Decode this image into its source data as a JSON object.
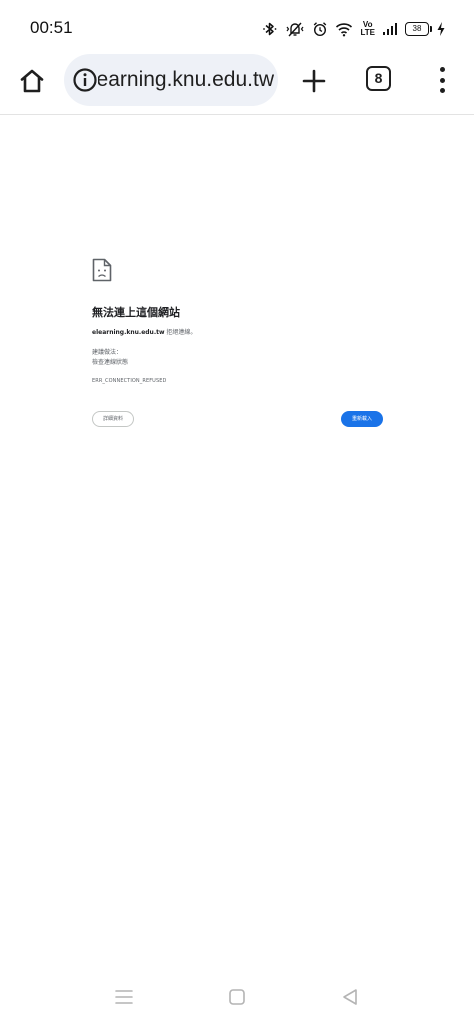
{
  "status_bar": {
    "time": "00:51",
    "network_label_top": "Vo",
    "network_label_bottom": "LTE",
    "battery_level": "38",
    "icons": [
      "bluetooth-icon",
      "vibrate-icon",
      "alarm-icon",
      "wifi-icon",
      "volte-icon",
      "signal-icon",
      "battery-icon",
      "charging-icon"
    ]
  },
  "toolbar": {
    "url": "elearning.knu.edu.tw",
    "tab_count": "8",
    "icons": [
      "home-icon",
      "info-icon",
      "plus-icon",
      "more-vert-icon"
    ]
  },
  "error_page": {
    "title": "無法連上這個網站",
    "host": "elearning.knu.edu.tw",
    "desc_suffix": " 拒絕連線。",
    "suggest_heading": "建議做法：",
    "suggest_item": "檢查連線狀態",
    "error_code": "ERR_CONNECTION_REFUSED",
    "details_label": "詳細資料",
    "reload_label": "重新載入"
  },
  "colors": {
    "accent": "#1a73e8",
    "omnibox_bg": "#eef1f7"
  }
}
